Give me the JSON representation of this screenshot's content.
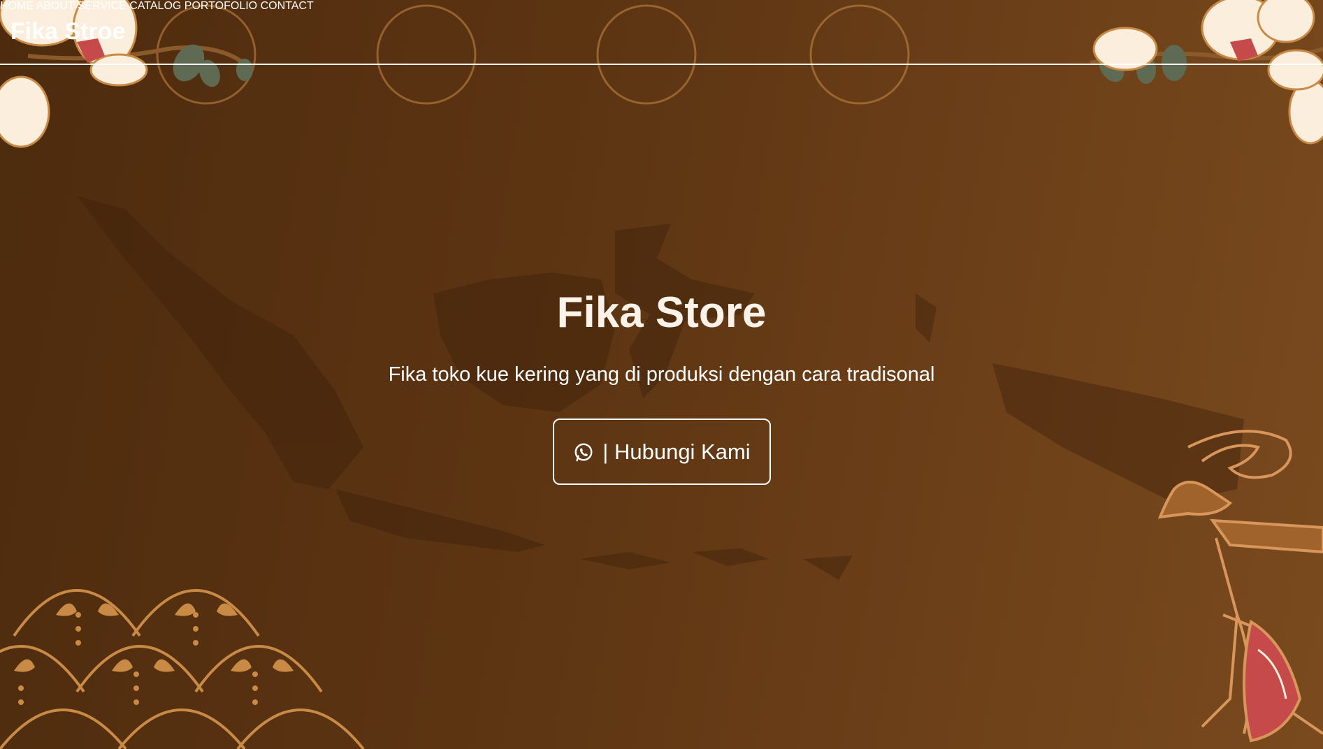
{
  "brand": "Fika Stroe",
  "nav": {
    "items": [
      "HOME",
      "ABOUT",
      "SERVICE",
      "CATALOG",
      "PORTOFOLIO",
      "CONTACT"
    ]
  },
  "hero": {
    "title": "Fika Store",
    "subtitle": "Fika toko kue kering yang di produksi dengan cara tradisonal",
    "cta_label": "| Hubungi Kami",
    "cta_icon": "whatsapp-icon"
  },
  "colors": {
    "background": "#5c3412",
    "accent": "#c98a45",
    "text": "#ffffff"
  }
}
